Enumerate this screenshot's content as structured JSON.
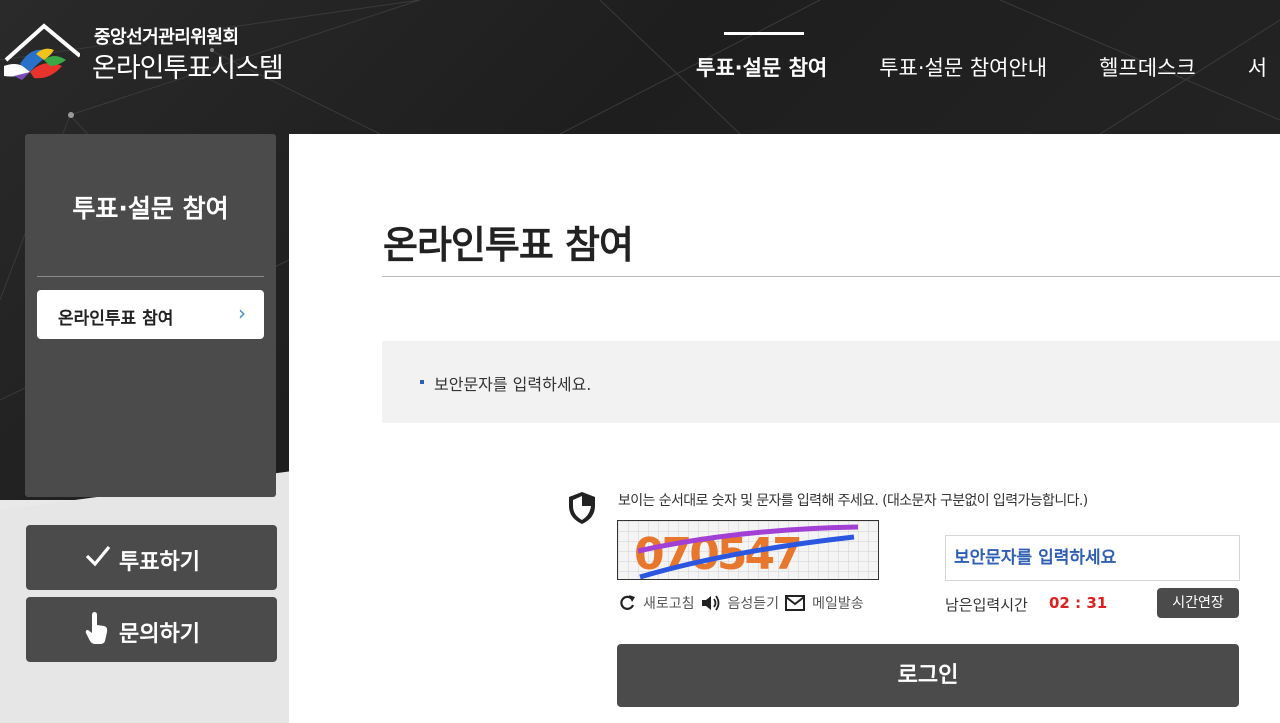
{
  "header": {
    "org_name": "중앙선거관리위원회",
    "system_name": "온라인투표시스템",
    "nav": [
      {
        "label": "투표·설문 참여"
      },
      {
        "label": "투표·설문 참여안내"
      },
      {
        "label": "헬프데스크"
      },
      {
        "label": "서"
      }
    ]
  },
  "sidebar": {
    "title": "투표·설문 참여",
    "items": [
      {
        "label": "온라인투표 참여"
      }
    ],
    "quick": [
      {
        "label": "투표하기",
        "icon": "check-icon"
      },
      {
        "label": "문의하기",
        "icon": "hand-pointer-icon"
      }
    ]
  },
  "main": {
    "title": "온라인투표 참여",
    "notice": "보안문자를 입력하세요.",
    "captcha": {
      "guide": "보이는 순서대로 숫자 및 문자를 입력해 주세요. (대소문자 구분없이 입력가능합니다.)",
      "code_display": "070547",
      "tools": [
        {
          "label": "새로고침",
          "icon": "refresh-icon"
        },
        {
          "label": "음성듣기",
          "icon": "speaker-icon"
        },
        {
          "label": "메일발송",
          "icon": "mail-icon"
        }
      ],
      "input_placeholder": "보안문자를 입력하세요",
      "time_label": "남은입력시간",
      "time_value": "02 : 31",
      "extend_label": "시간연장"
    },
    "login_label": "로그인"
  },
  "colors": {
    "panel": "#4b4b4b",
    "accent_blue": "#2f5fb4",
    "timer_red": "#e02020"
  }
}
